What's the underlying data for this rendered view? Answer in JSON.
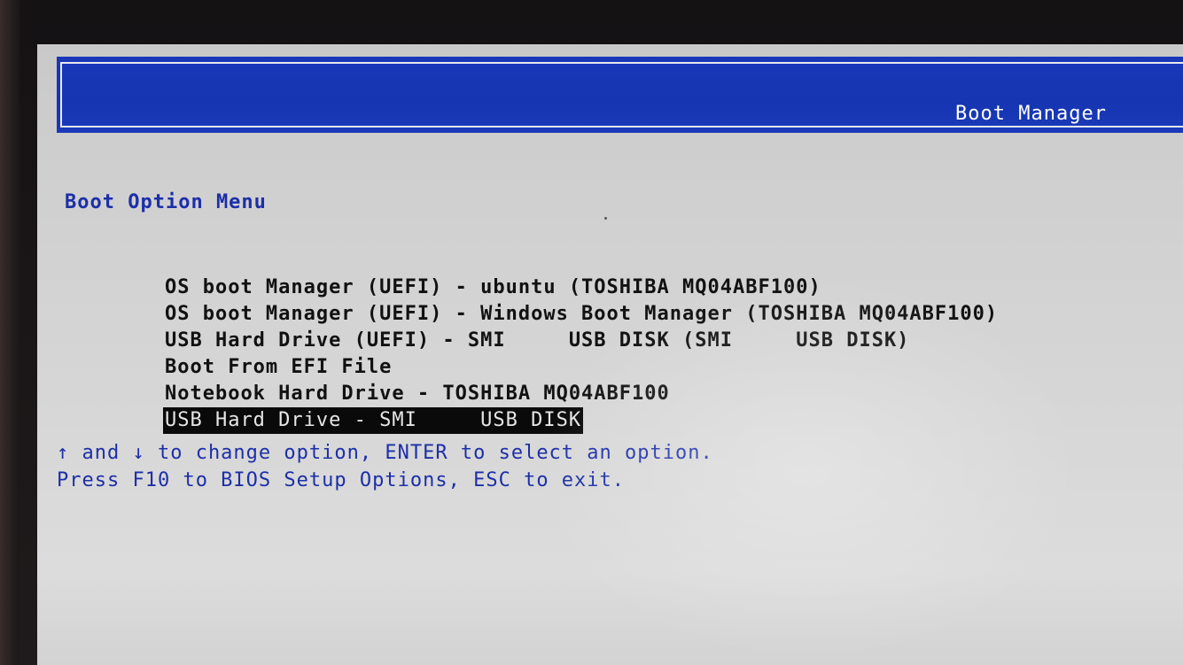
{
  "window": {
    "title": "Boot Manager"
  },
  "menu": {
    "heading": "Boot Option Menu",
    "options": [
      {
        "label": "OS boot Manager (UEFI) - ubuntu (TOSHIBA MQ04ABF100)",
        "selected": false
      },
      {
        "label": "OS boot Manager (UEFI) - Windows Boot Manager (TOSHIBA MQ04ABF100)",
        "selected": false
      },
      {
        "label": "USB Hard Drive (UEFI) - SMI     USB DISK (SMI     USB DISK)",
        "selected": false
      },
      {
        "label": "Boot From EFI File",
        "selected": false
      },
      {
        "label": "Notebook Hard Drive - TOSHIBA MQ04ABF100",
        "selected": false
      },
      {
        "label": "USB Hard Drive - SMI     USB DISK",
        "selected": true
      }
    ]
  },
  "help": {
    "line1": "↑ and ↓ to change option, ENTER to select an option.",
    "line2": "Press F10 to BIOS Setup Options, ESC to exit."
  },
  "colors": {
    "title_bar": "#1838b8",
    "screen_bg": "#d0d0d0",
    "heading_text": "#1c2fa8",
    "option_text": "#111111",
    "selected_bg": "#0a0a0a",
    "selected_text": "#e6e6e6"
  }
}
